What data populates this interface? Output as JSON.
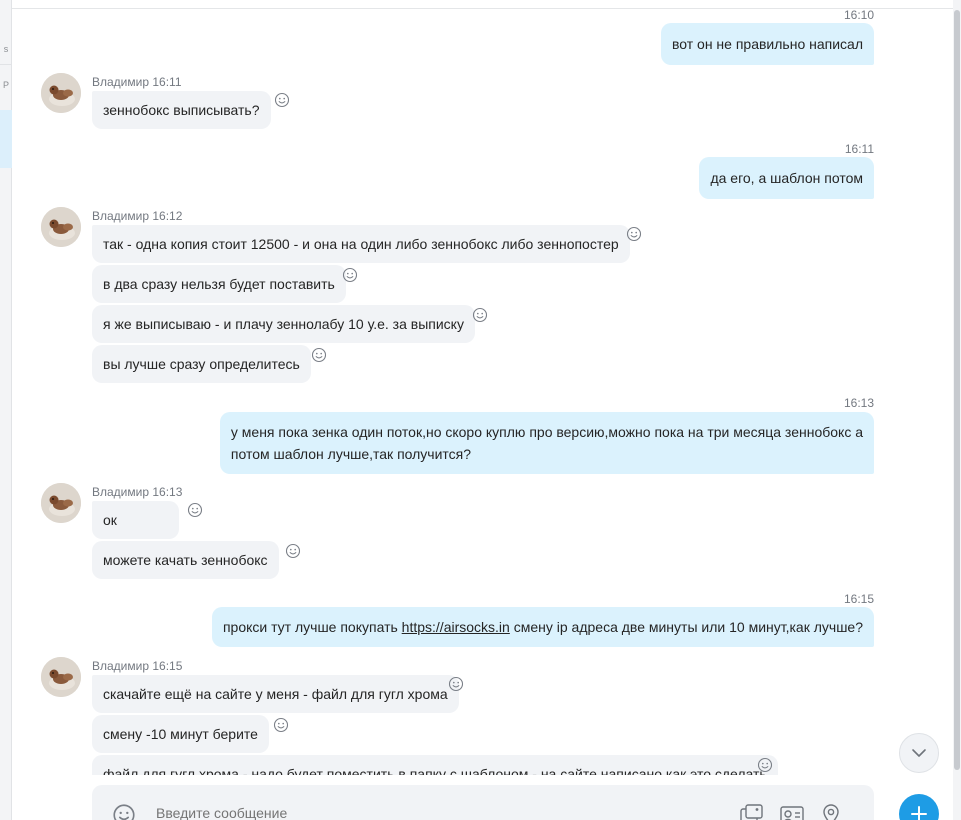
{
  "colors": {
    "outgoing_bubble": "#dbf2fd",
    "incoming_bubble": "#f1f3f6",
    "accent": "#1e9ce5",
    "meta_text": "#737880"
  },
  "sidebar": {
    "partial_char_1": "s",
    "partial_char_2": "P"
  },
  "messages": {
    "m1": {
      "time": "16:10",
      "text": "вот он не правильно написал"
    },
    "g1": {
      "sender": "Владимир",
      "time": "16:11",
      "lines": [
        "зеннобокс выписывать?"
      ]
    },
    "m2": {
      "time": "16:11",
      "text": "да его, а шаблон потом"
    },
    "g2": {
      "sender": "Владимир",
      "time": "16:12",
      "lines": [
        "так - одна копия стоит 12500 - и она на один либо зеннобокс либо зеннопостер",
        "в два сразу нельзя будет поставить",
        "я же выписываю - и плачу зеннолабу 10 у.е. за выписку",
        "вы лучше сразу определитесь"
      ]
    },
    "m3": {
      "time": "16:13",
      "line1": "у меня пока зенка один поток,но скоро куплю про версию,можно пока на три месяца зеннобокс а",
      "line2": "потом шаблон лучше,так получится?"
    },
    "g3": {
      "sender": "Владимир",
      "time": "16:13",
      "lines": [
        "ок",
        "можете качать зеннобокс"
      ]
    },
    "m4": {
      "time": "16:15",
      "before": "прокси тут лучше покупать ",
      "link": "https://airsocks.in",
      "after": " смену ip адреса две минуты или 10 минут,как лучше?"
    },
    "g4": {
      "sender": "Владимир",
      "time": "16:15",
      "lines": [
        "скачайте ещё на сайте у меня - файл для гугл хрома",
        "смену -10 минут берите",
        "файл для гугл хрома - надо будет поместить в папку с шаблоном - на сайте написано как это сделать"
      ]
    }
  },
  "composer": {
    "placeholder": "Введите сообщение"
  },
  "icons": {
    "emoji": "smile-icon",
    "scroll_down": "chevron-down-icon",
    "media": "media-gallery-icon",
    "contact": "contact-card-icon",
    "location": "location-pin-icon",
    "add": "plus-icon"
  }
}
